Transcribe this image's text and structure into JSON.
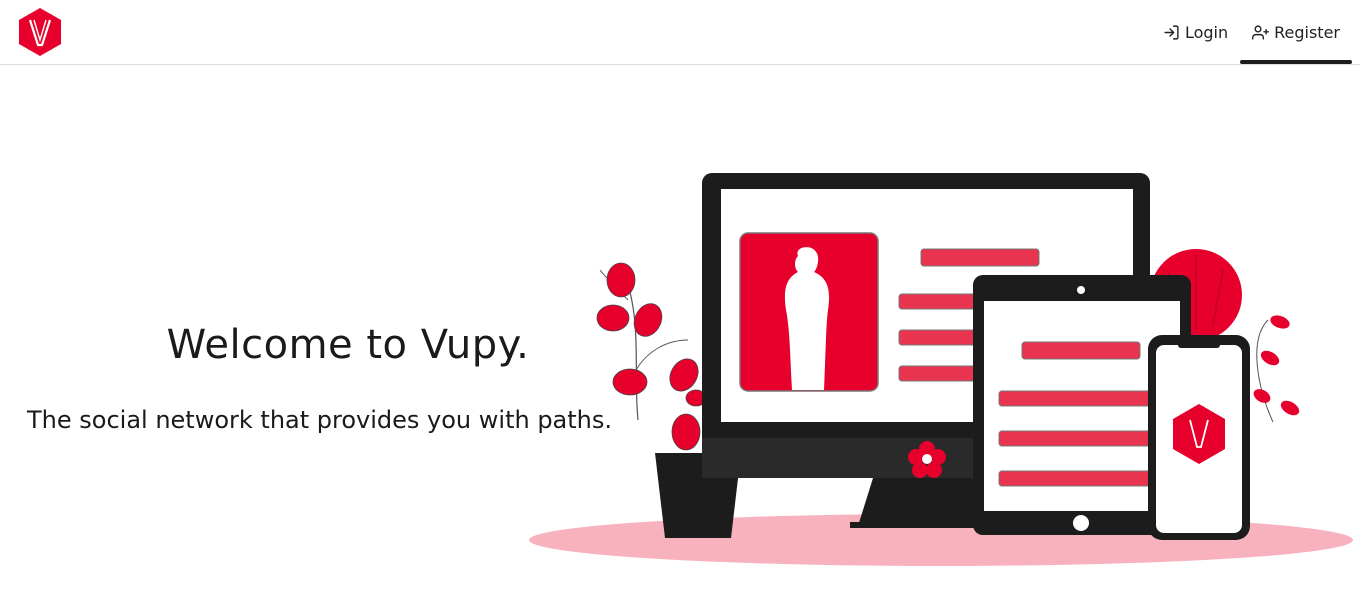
{
  "app": {
    "name": "Vupy"
  },
  "header": {
    "logo_icon": "vupy-hexagon-logo",
    "nav": [
      {
        "label": "Login",
        "icon": "login-icon",
        "active": false
      },
      {
        "label": "Register",
        "icon": "user-plus-icon",
        "active": true
      }
    ]
  },
  "hero": {
    "title": "Welcome to Vupy.",
    "subtitle": "The social network that provides you with paths."
  },
  "colors": {
    "brand_red": "#e8002d",
    "bar_red": "#e8344f",
    "floor_pink": "#f7b2bd",
    "device_dark": "#1c1c1c"
  }
}
